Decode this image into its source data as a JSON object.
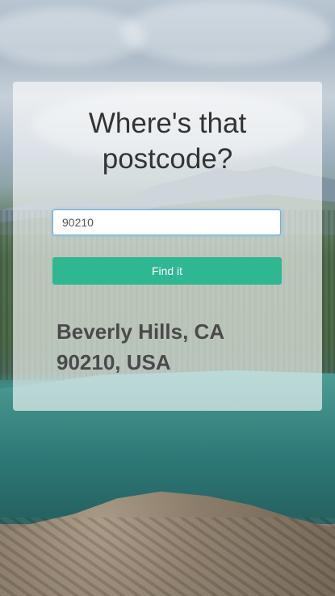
{
  "page": {
    "title_line1": "Where's that",
    "title_line2": "postcode?"
  },
  "search": {
    "value": "90210",
    "button_label": "Find it"
  },
  "result": {
    "line1": "Beverly Hills, CA",
    "line2": "90210, USA"
  }
}
